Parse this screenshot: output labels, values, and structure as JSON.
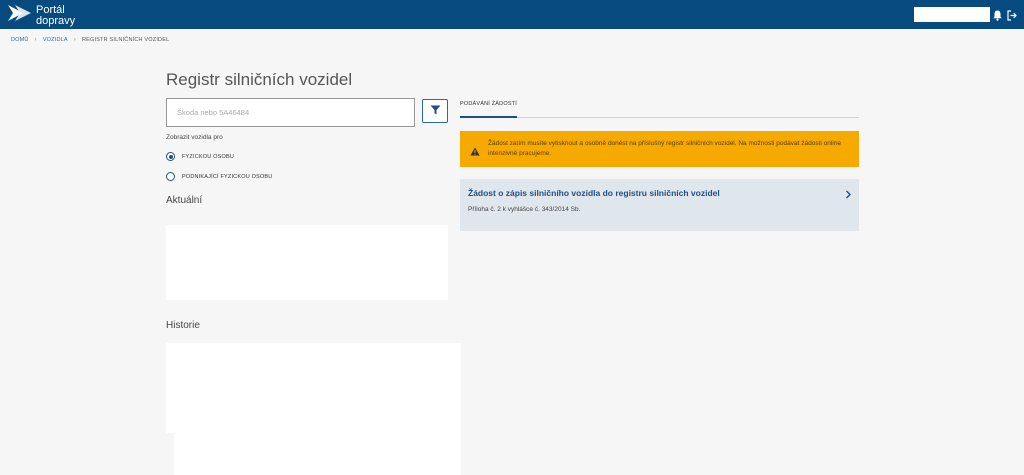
{
  "header": {
    "logo_line1": "Portál",
    "logo_line2": "dopravy",
    "icons": [
      "logo-icon",
      "bell-icon",
      "logout-icon"
    ]
  },
  "breadcrumb": {
    "items": [
      "DOMŮ",
      "VOZIDLA",
      "REGISTR SILNIČNÍCH VOZIDEL"
    ]
  },
  "main": {
    "title": "Registr silničních vozidel",
    "search": {
      "placeholder": "Škoda nebo 5A46484",
      "value": ""
    },
    "show_for_label": "Zobrazit vozidla pro",
    "radios": [
      {
        "label": "FYZICKOU OSOBU",
        "checked": true
      },
      {
        "label": "PODNIKAJÍCÍ FYZICKOU OSOBU",
        "checked": false
      }
    ],
    "current_title": "Aktuální",
    "history_title": "Historie"
  },
  "right": {
    "tab_label": "PODÁVÁNÍ ŽÁDOSTÍ",
    "warning_text": "Žádost zatím musíte vytisknout a osobně donést na příslušný registr silničních vozidel. Na možnosti podávat žádosti online intenzivně pracujeme.",
    "card": {
      "title": "Žádost o zápis silničního vozidla do registru silničních vozidel",
      "subtitle": "Příloha č. 2 k vyhlášce č. 343/2014 Sb."
    }
  },
  "colors": {
    "header": "#064a80",
    "accent": "#1f4f86",
    "warning": "#f6aa00",
    "card": "#dfe6ec"
  }
}
